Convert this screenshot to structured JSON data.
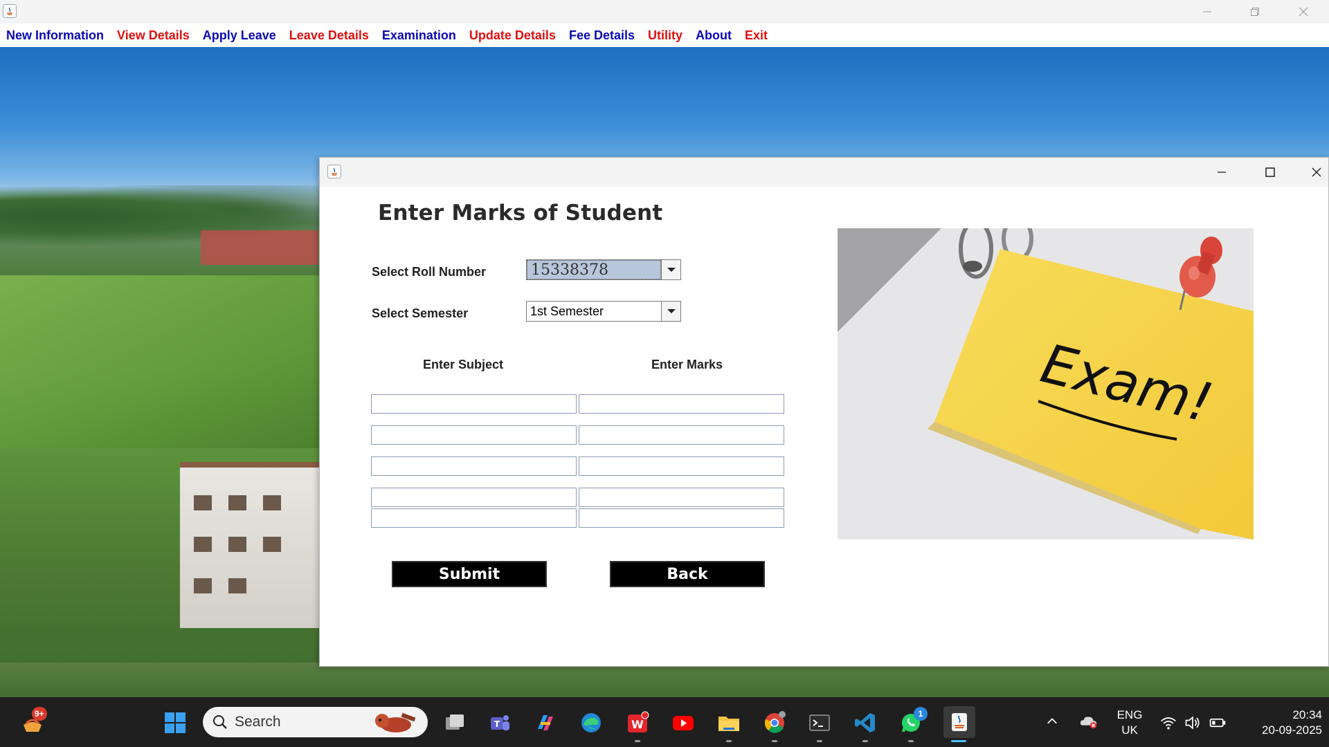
{
  "menu": {
    "items": [
      {
        "label": "New Information",
        "color": "blue"
      },
      {
        "label": "View Details",
        "color": "red"
      },
      {
        "label": "Apply Leave",
        "color": "blue"
      },
      {
        "label": "Leave Details",
        "color": "red"
      },
      {
        "label": "Examination",
        "color": "blue"
      },
      {
        "label": "Update Details",
        "color": "red"
      },
      {
        "label": "Fee Details",
        "color": "blue"
      },
      {
        "label": "Utility",
        "color": "red"
      },
      {
        "label": "About",
        "color": "blue"
      },
      {
        "label": "Exit",
        "color": "red"
      }
    ]
  },
  "dialog": {
    "title": "Enter Marks of Student",
    "roll_label": "Select Roll Number",
    "roll_value": "15338378",
    "semester_label": "Select Semester",
    "semester_value": "1st Semester",
    "subject_header": "Enter Subject",
    "marks_header": "Enter Marks",
    "rows": 5,
    "submit_label": "Submit",
    "back_label": "Back",
    "image_text": "Exam!"
  },
  "taskbar": {
    "search_placeholder": "Search",
    "widget_badge": "9+",
    "whatsapp_badge": "1",
    "language_line1": "ENG",
    "language_line2": "UK",
    "time": "20:34",
    "date": "20-09-2025"
  },
  "colors": {
    "menu_blue": "#0a0ab4",
    "menu_red": "#e01010",
    "button_bg": "#000000",
    "note_yellow": "#f7d64a"
  }
}
